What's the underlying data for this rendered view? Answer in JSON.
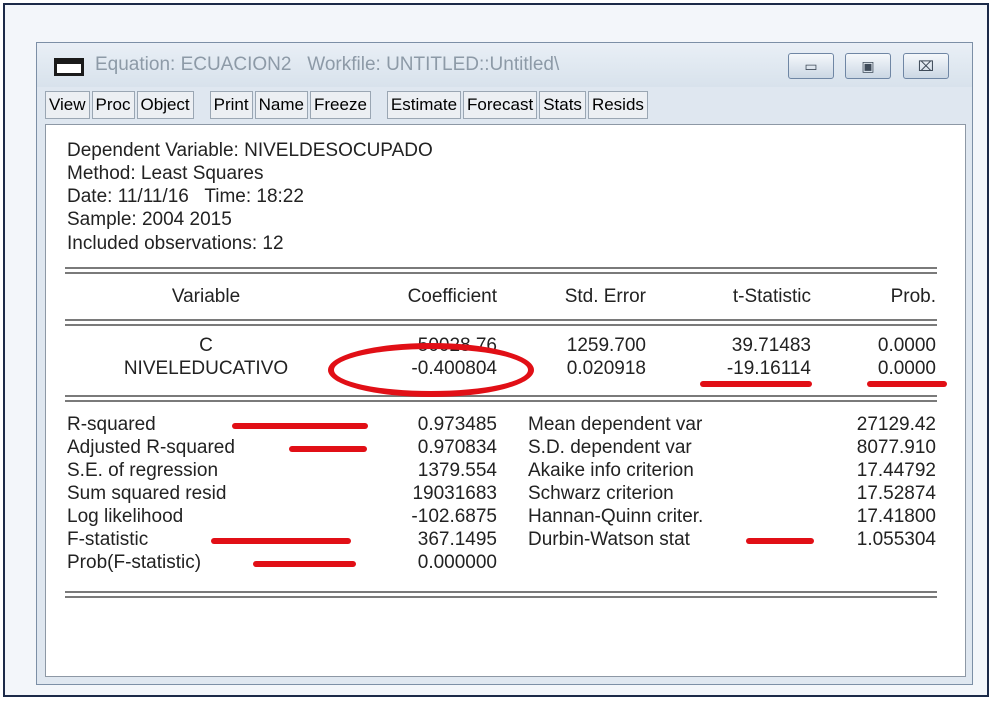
{
  "window": {
    "title": "Equation: ECUACION2   Workfile: UNTITLED::Untitled\\",
    "minimize_icon": "minimize-icon",
    "maximize_icon": "maximize-icon",
    "close_label": "⌧"
  },
  "toolbar": [
    "View",
    "Proc",
    "Object",
    "Print",
    "Name",
    "Freeze",
    "Estimate",
    "Forecast",
    "Stats",
    "Resids"
  ],
  "header_lines": [
    "Dependent Variable: NIVELDESOCUPADO",
    "Method: Least Squares",
    "Date: 11/11/16   Time: 18:22",
    "Sample: 2004 2015",
    "Included observations: 12"
  ],
  "coef_table": {
    "columns": [
      "Variable",
      "Coefficient",
      "Std. Error",
      "t-Statistic",
      "Prob."
    ],
    "rows": [
      [
        "C",
        "50028.76",
        "1259.700",
        "39.71483",
        "0.0000"
      ],
      [
        "NIVELEDUCATIVO",
        "-0.400804",
        "0.020918",
        "-19.16114",
        "0.0000"
      ]
    ]
  },
  "stats": {
    "left": [
      [
        "R-squared",
        "0.973485"
      ],
      [
        "Adjusted R-squared",
        "0.970834"
      ],
      [
        "S.E. of regression",
        "1379.554"
      ],
      [
        "Sum squared resid",
        "19031683"
      ],
      [
        "Log likelihood",
        "-102.6875"
      ],
      [
        "F-statistic",
        "367.1495"
      ],
      [
        "Prob(F-statistic)",
        "0.000000"
      ]
    ],
    "right": [
      [
        "Mean dependent var",
        "27129.42"
      ],
      [
        "S.D. dependent var",
        "8077.910"
      ],
      [
        "Akaike info criterion",
        "17.44792"
      ],
      [
        "Schwarz criterion",
        "17.52874"
      ],
      [
        "Hannan-Quinn criter.",
        "17.41800"
      ],
      [
        "Durbin-Watson stat",
        "1.055304"
      ]
    ]
  },
  "annotation_color": "#e10f16"
}
